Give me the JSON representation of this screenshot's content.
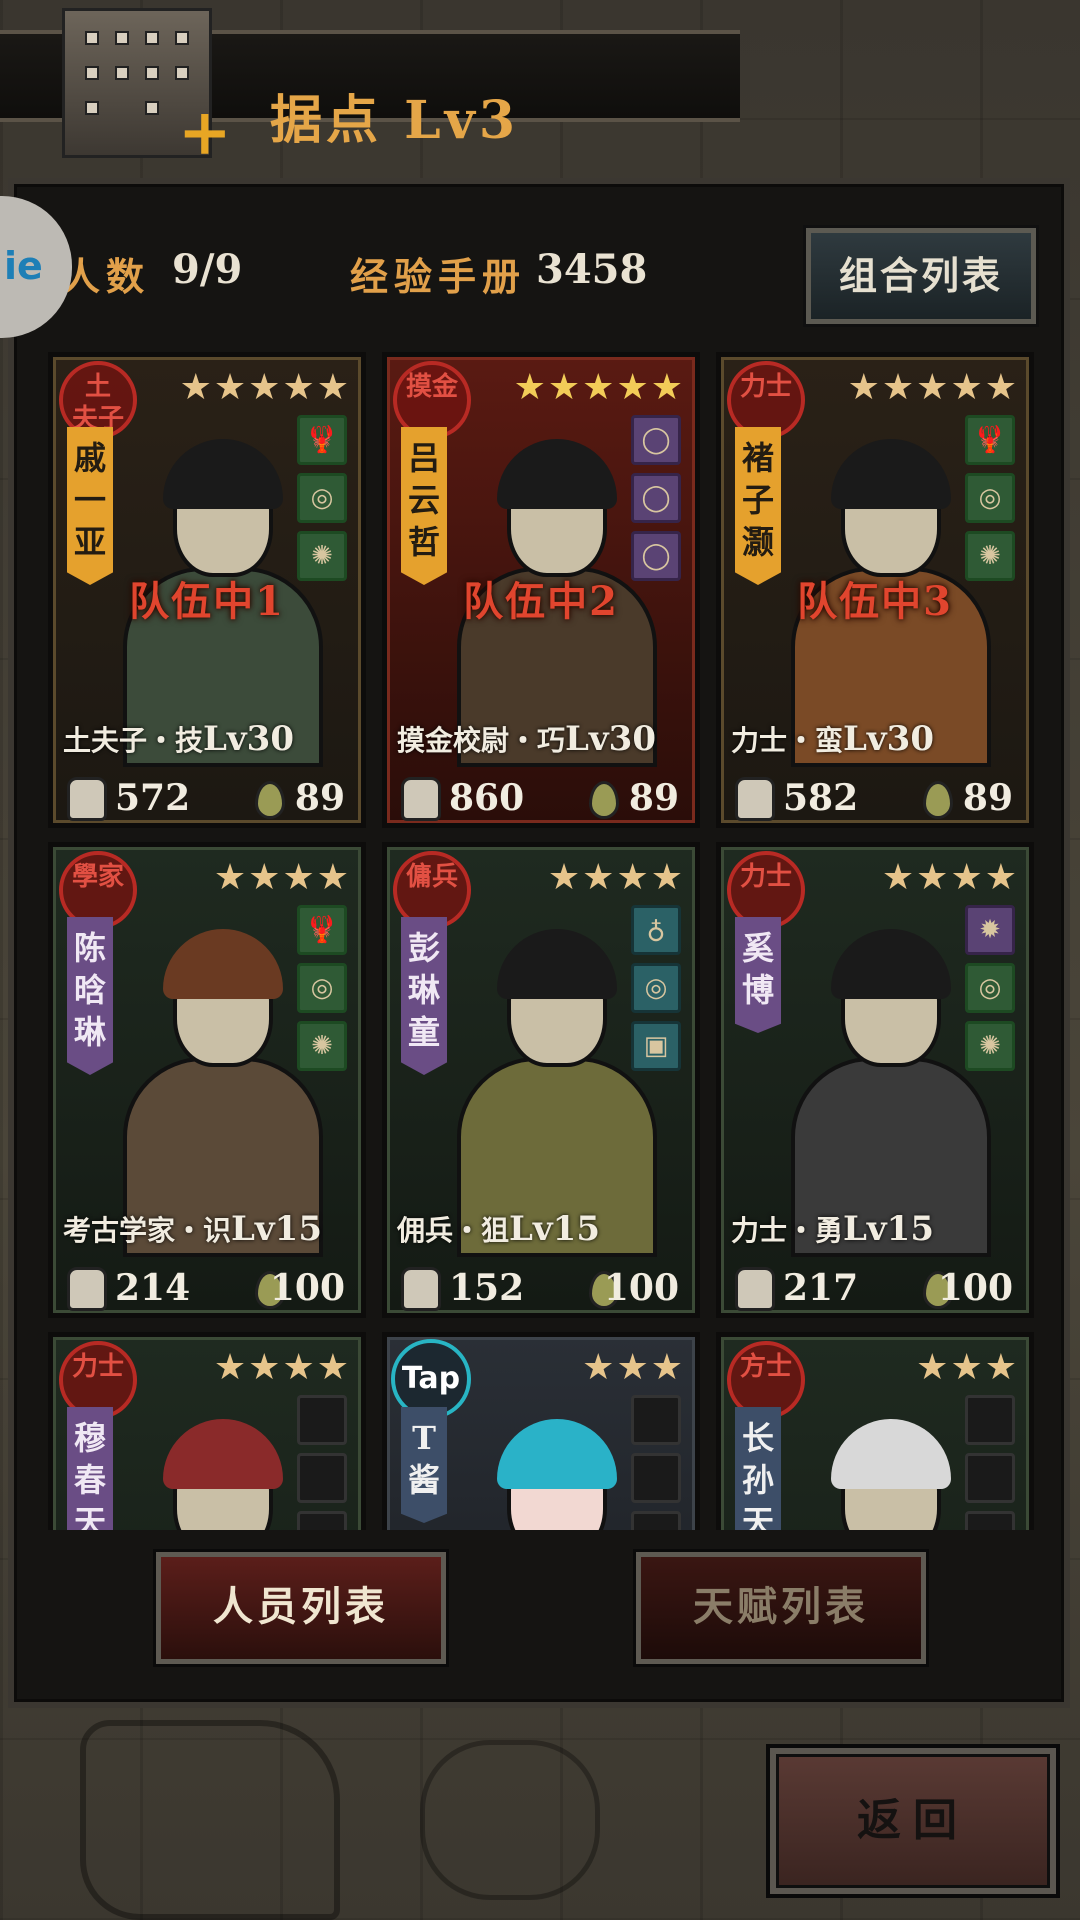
{
  "header": {
    "title": "据点 Lv3"
  },
  "stats": {
    "people_label": "人数",
    "people_value": "9/9",
    "exp_label": "经验手册",
    "exp_value": "3458",
    "side_tab": "ie"
  },
  "combo_button": "组合列表",
  "cards": [
    {
      "seal": "土夫子",
      "stars": "★★★★★",
      "name": "戚一亚",
      "team": "队伍中1",
      "cls": "土夫子・技",
      "lv": "Lv30",
      "power": "572",
      "stamina": "89",
      "items": [
        "🦞",
        "◎",
        "✺"
      ]
    },
    {
      "seal": "摸金",
      "stars": "★★★★★",
      "name": "吕云哲",
      "team": "队伍中2",
      "cls": "摸金校尉・巧",
      "lv": "Lv30",
      "power": "860",
      "stamina": "89",
      "items": [
        "◯",
        "◯",
        "◯"
      ]
    },
    {
      "seal": "力士",
      "stars": "★★★★★",
      "name": "褚子灏",
      "team": "队伍中3",
      "cls": "力士・蛮",
      "lv": "Lv30",
      "power": "582",
      "stamina": "89",
      "items": [
        "🦞",
        "◎",
        "✺"
      ]
    },
    {
      "seal": "學家",
      "stars": "★★★★",
      "name": "陈晗琳",
      "team": "",
      "cls": "考古学家・识",
      "lv": "Lv15",
      "power": "214",
      "stamina": "100",
      "items": [
        "🦞",
        "◎",
        "✺"
      ]
    },
    {
      "seal": "傭兵",
      "stars": "★★★★",
      "name": "彭琳童",
      "team": "",
      "cls": "佣兵・狙",
      "lv": "Lv15",
      "power": "152",
      "stamina": "100",
      "items": [
        "♁",
        "◎",
        "▣"
      ]
    },
    {
      "seal": "力士",
      "stars": "★★★★",
      "name": "奚博",
      "team": "",
      "cls": "力士・勇",
      "lv": "Lv15",
      "power": "217",
      "stamina": "100",
      "items": [
        "✹",
        "◎",
        "✺"
      ]
    },
    {
      "seal": "力士",
      "stars": "★★★★",
      "name": "穆春天",
      "team": "",
      "cls": "",
      "lv": "",
      "power": "",
      "stamina": "",
      "items": [
        "",
        "",
        ""
      ]
    },
    {
      "seal": "Tap",
      "stars": "★★★",
      "name": "T酱",
      "team": "",
      "cls": "",
      "lv": "",
      "power": "",
      "stamina": "",
      "items": [
        "",
        "",
        ""
      ]
    },
    {
      "seal": "方士",
      "stars": "★★★",
      "name": "长孙天",
      "team": "",
      "cls": "",
      "lv": "",
      "power": "",
      "stamina": "",
      "items": [
        "",
        "",
        ""
      ]
    }
  ],
  "bottom": {
    "left": "人员列表",
    "right": "天赋列表"
  },
  "back_button": "返回"
}
